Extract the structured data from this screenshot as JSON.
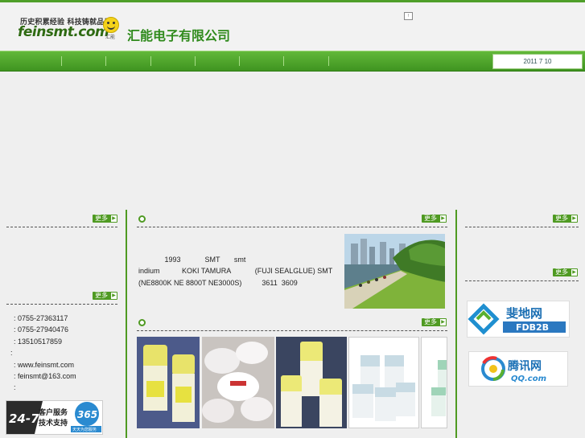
{
  "header": {
    "slogan": "历史积累经验  科技铸就品质",
    "logo_text": "feinsmt.com",
    "logo_small": "汇能",
    "company_name": "汇能电子有限公司",
    "top_icon": "↑"
  },
  "nav": {
    "date": "2011 7 10"
  },
  "more_label": "更多",
  "more_arrow": "▶",
  "contacts": [
    ": 0755-27363117",
    ": 0755-27940476",
    ": 13510517859",
    ":",
    ": www.feinsmt.com",
    ": feinsmt@163.com",
    ":"
  ],
  "intro_lines": [
    "             1993            SMT       smt",
    "indium           KOKI TAMURA            (FUJI SEALGLUE) SMT",
    "(NE8800K NE 8800T NE3000S)          3611  3609"
  ],
  "badge": {
    "big": "24-7",
    "line1": "客户服务",
    "line2": "技术支持",
    "num": "365",
    "sub": "天天为您服务"
  },
  "partners": {
    "fdb2b_cn": "斐地网",
    "fdb2b_en": "FDB2B",
    "qq_cn": "腾讯网",
    "qq_en": "QQ.com"
  },
  "colors": {
    "brand_green": "#4f9a22",
    "nav_green": "#4fa62a"
  }
}
